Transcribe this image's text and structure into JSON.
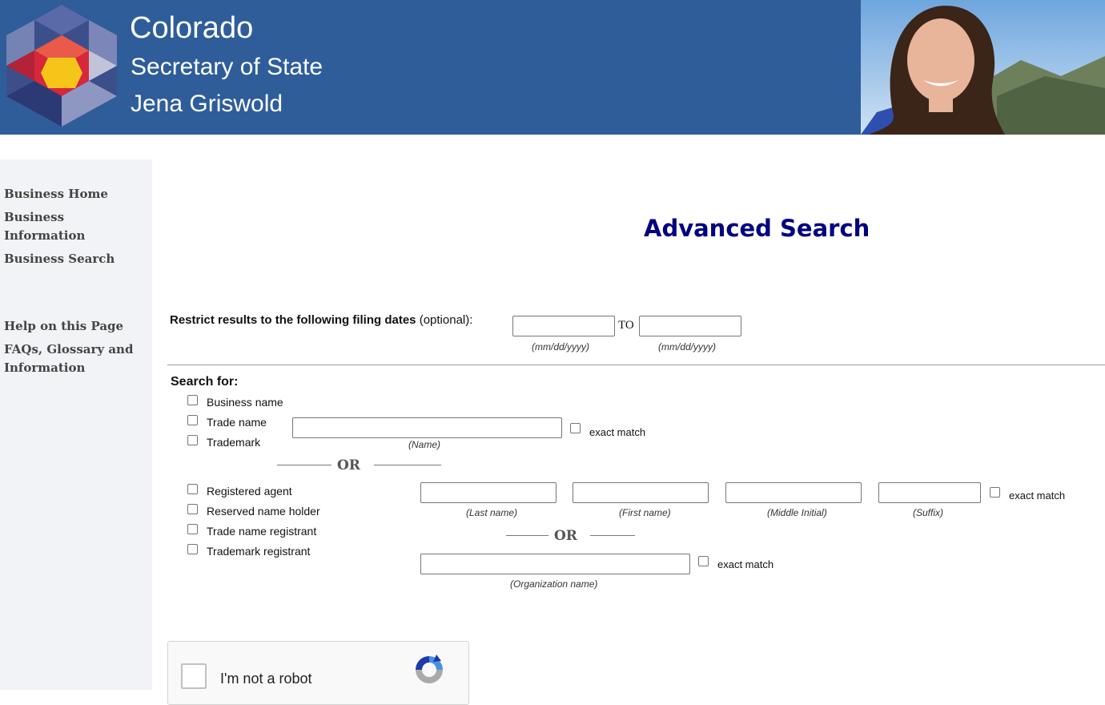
{
  "header": {
    "title": "Colorado",
    "subtitle1": "Secretary of State",
    "subtitle2": "Jena Griswold",
    "brand_color": "#2e5d9a"
  },
  "sidebar": {
    "items": [
      {
        "label": "Business Home"
      },
      {
        "label": "Business Information"
      },
      {
        "label": "Business Search"
      },
      {
        "label": "Help on this Page"
      },
      {
        "label": "FAQs, Glossary and Information"
      }
    ]
  },
  "main": {
    "page_title": "Advanced Search",
    "date_restrict": {
      "label_bold": "Restrict results to the following filing dates",
      "label_optional": " (optional):",
      "from_value": "",
      "to_label": "TO",
      "to_value": "",
      "from_hint": "(mm/dd/yyyy)",
      "to_hint": "(mm/dd/yyyy)"
    },
    "search_for_label": "Search for:",
    "group1": {
      "options": [
        "Business name",
        "Trade name",
        "Trademark"
      ],
      "name_value": "",
      "name_hint": "(Name)",
      "exact_match": "exact match"
    },
    "or_label": "OR",
    "group2": {
      "options": [
        "Registered agent",
        "Reserved name holder",
        "Trade name registrant",
        "Trademark registrant"
      ],
      "person_hints": [
        "(Last name)",
        "(First name)",
        "(Middle Initial)",
        "(Suffix)"
      ],
      "person_exact_match": "exact match",
      "or_label": "OR",
      "org_hint": "(Organization name)",
      "org_exact_match": "exact match"
    }
  },
  "captcha": {
    "label": "I'm not a robot"
  }
}
